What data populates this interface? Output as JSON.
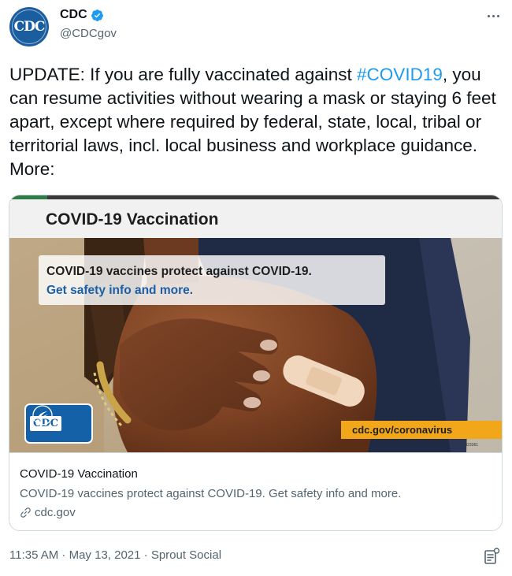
{
  "account": {
    "display_name": "CDC",
    "handle": "@CDCgov",
    "avatar_text": "CDC"
  },
  "tweet": {
    "text_before": "UPDATE: If you are fully vaccinated against ",
    "hashtag": "#COVID19",
    "text_after": ", you can resume activities without wearing a mask or staying 6 feet apart, except where required by federal, state, local, tribal or territorial laws, incl. local business and workplace guidance. More:"
  },
  "card": {
    "image": {
      "title": "COVID-19 Vaccination",
      "info_line1": "COVID-19 vaccines protect against COVID-19.",
      "info_line2": "Get safety info and more.",
      "logo_text": "CDC",
      "url_banner": "cdc.gov/coronavirus",
      "doc_code": "CS 323361"
    },
    "title": "COVID-19 Vaccination",
    "description": "COVID-19 vaccines protect against COVID-19. Get safety info and more.",
    "domain": "cdc.gov"
  },
  "footer": {
    "timestamp": "11:35 AM · May 13, 2021 · Sprout Social"
  },
  "colors": {
    "link": "#1d9bf0",
    "secondary_text": "#536471",
    "brand_blue": "#1561a8",
    "banner_orange": "#f2a71b"
  },
  "icons": [
    "verified-badge-icon",
    "more-options-icon",
    "link-icon",
    "view-stats-icon",
    "hhs-eagle-icon"
  ]
}
